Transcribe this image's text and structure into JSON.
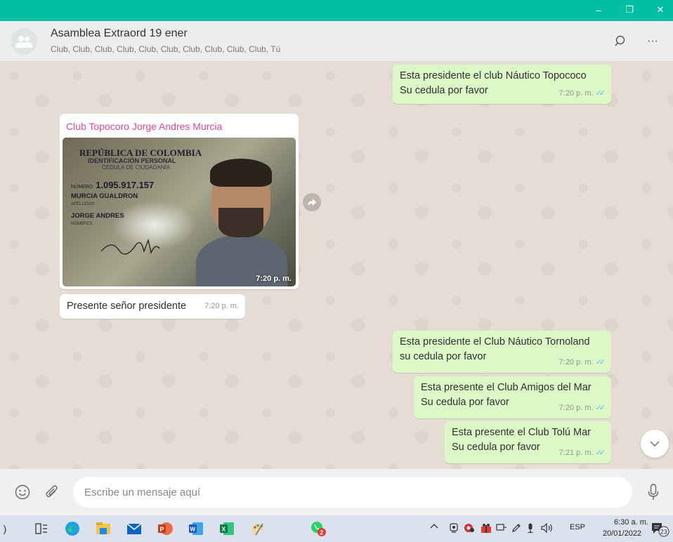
{
  "window": {
    "title_bar_color": "#00bfa5",
    "controls": {
      "minimize": "–",
      "maximize": "❐",
      "close": "✕"
    }
  },
  "header": {
    "title": "Asamblea Extraord 19 ener",
    "subtitle": "Club, Club, Club, Club, Club, Club, Club, Club, Club, Club, Tú",
    "avatar_icon": "group-icon",
    "search_icon": "search-icon",
    "menu_label": "···"
  },
  "messages": [
    {
      "direction": "out",
      "lines": [
        "Esta presidente el club Náutico Topococo",
        "Su cedula por favor"
      ],
      "time": "7:20 p. m.",
      "ticks": "✓✓"
    },
    {
      "direction": "in",
      "sender": "Club Topocoro Jorge Andres Murcia",
      "image": {
        "header": "REPÚBLICA DE COLOMBIA",
        "sub1": "IDENTIFICACIÓN PERSONAL",
        "sub2": "CÉDULA DE CIUDADANÍA",
        "number_label": "NÚMERO",
        "number": "1.095.917.157",
        "surname": "MURCIA GUALDRON",
        "surname_label": "APELLIDOS",
        "given_name": "JORGE ANDRES",
        "given_label": "NOMBRES"
      },
      "time": "7:20 p. m."
    },
    {
      "direction": "in",
      "lines": [
        "Presente señor presidente"
      ],
      "time": "7:20 p. m."
    },
    {
      "direction": "out",
      "lines": [
        "Esta presidente el Club Náutico Tornoland",
        "su cedula por favor"
      ],
      "time": "7:20 p. m.",
      "ticks": "✓✓"
    },
    {
      "direction": "out",
      "lines": [
        "Esta presente el Club Amigos del Mar",
        "Su cedula por favor"
      ],
      "time": "7:20 p. m.",
      "ticks": "✓✓"
    },
    {
      "direction": "out",
      "lines": [
        "Esta presente el Club Tolú Mar",
        "Su cedula por favor"
      ],
      "time": "7:21 p. m.",
      "ticks": "✓✓"
    }
  ],
  "composer": {
    "placeholder": "Escribe un mensaje aquí",
    "emoji_icon": "emoji-icon",
    "attach_icon": "paperclip-icon",
    "mic_icon": "microphone-icon"
  },
  "taskbar": {
    "apps": [
      "task-view-icon",
      "edge-icon",
      "file-explorer-icon",
      "mail-icon",
      "powerpoint-icon",
      "word-icon",
      "excel-icon",
      "paint-icon",
      "whatsapp-icon"
    ],
    "whatsapp_badge": "2",
    "language": "ESP",
    "clock_time": "6:30 a. m.",
    "clock_date": "20/01/2022",
    "notification_count": "23"
  },
  "colors": {
    "outgoing_bubble": "#dcf8c6",
    "incoming_bubble": "#ffffff",
    "sender_name": "#e542a3",
    "read_ticks": "#4fc3f7"
  }
}
